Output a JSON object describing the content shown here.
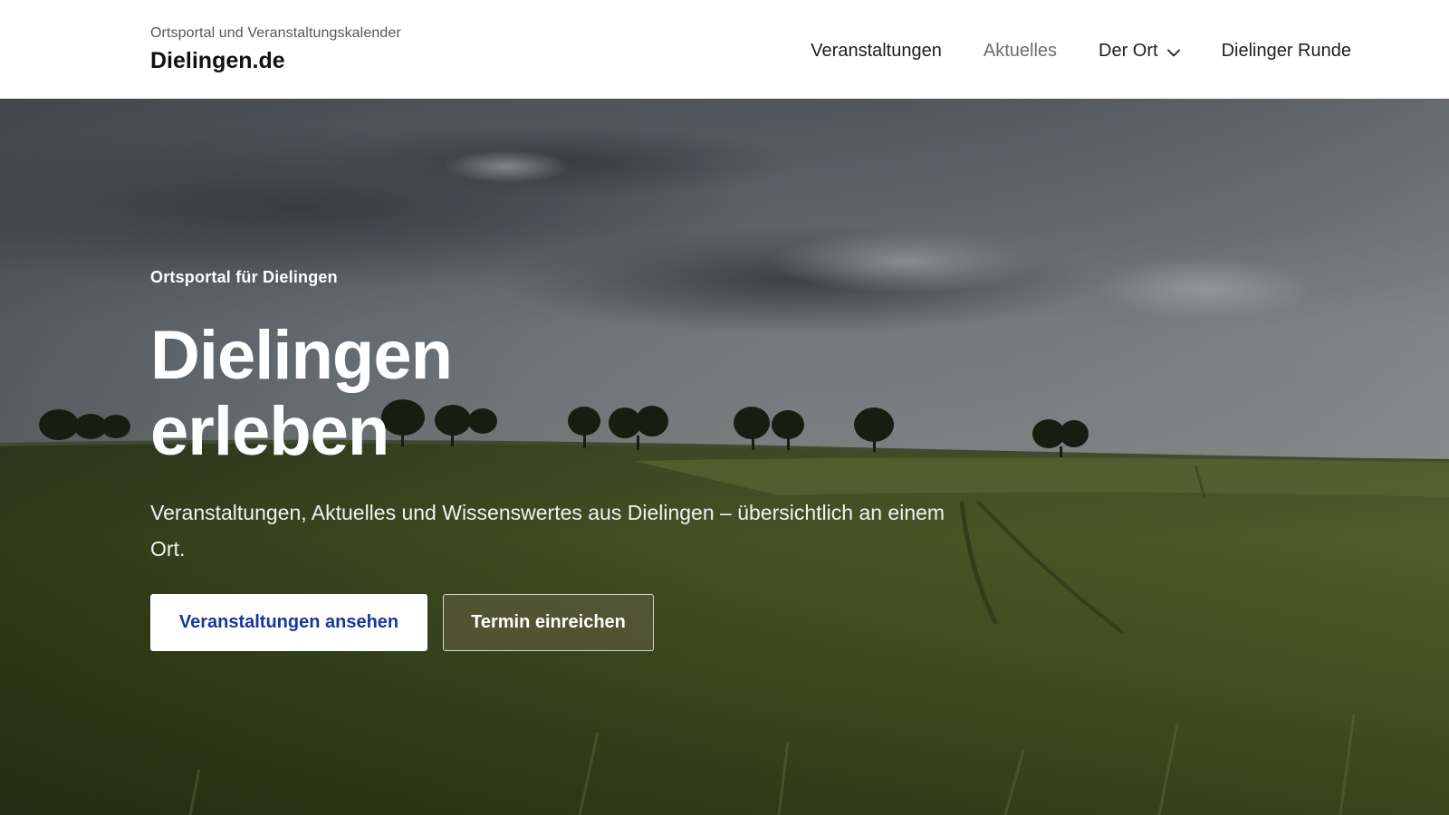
{
  "header": {
    "tagline": "Ortsportal und Veranstaltungskalender",
    "site_name": "Dielingen.de",
    "nav": [
      {
        "label": "Veranstaltungen",
        "active": false
      },
      {
        "label": "Aktuelles",
        "active": true
      },
      {
        "label": "Der Ort",
        "has_dropdown": true
      },
      {
        "label": "Dielinger Runde",
        "active": false
      }
    ]
  },
  "hero": {
    "eyebrow": "Ortsportal für Dielingen",
    "title_line1": "Dielingen",
    "title_line2": "erleben",
    "lead": "Veranstaltungen, Aktuelles und Wissenswertes aus Dielingen – übersichtlich an einem Ort.",
    "primary_button": "Veranstaltungen ansehen",
    "secondary_button": "Termin einreichen",
    "background": "landscape-photo-wheat-field-trees"
  },
  "colors": {
    "primary_button_text": "#17379c",
    "secondary_button_bg": "#545634",
    "header_text": "#1d1d1f",
    "nav_active": "#6b6d72"
  }
}
